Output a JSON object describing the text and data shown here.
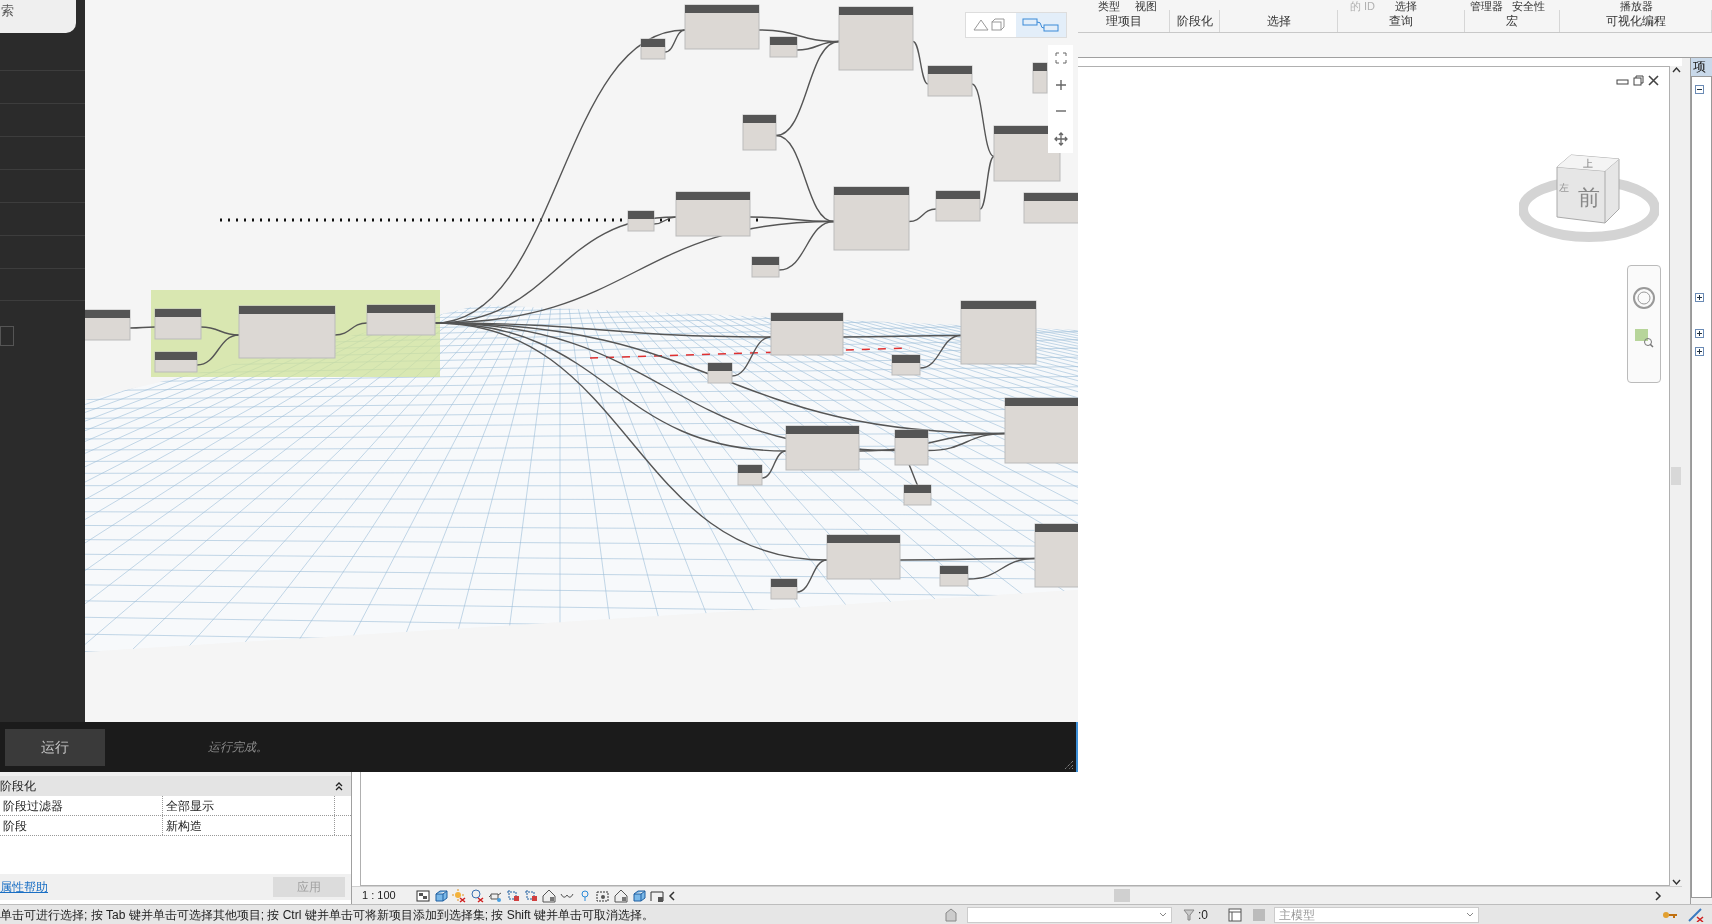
{
  "dynamo": {
    "search_field": {
      "value": "索"
    },
    "view_toggle": [
      {
        "selected": false
      },
      {
        "selected": true
      }
    ],
    "run_button": "运行",
    "run_message": "运行完成。"
  },
  "ribbon": {
    "tab_fragments": [
      {
        "label": "类型",
        "disabled": false
      },
      {
        "label": "视图",
        "disabled": false
      },
      {
        "label": "的 ID",
        "disabled": true
      },
      {
        "label": "选择",
        "disabled": false
      },
      {
        "label": "管理器",
        "disabled": false
      },
      {
        "label": "安全性",
        "disabled": false
      },
      {
        "label": "播放器",
        "disabled": false
      }
    ],
    "panels": [
      "理项目",
      "阶段化",
      "选择",
      "查询",
      "宏",
      "可视化编程"
    ]
  },
  "viewcube": {
    "faces": [
      "上",
      "左",
      "前"
    ]
  },
  "project_browser": {
    "header": "项"
  },
  "properties": {
    "group": {
      "label": "阶段化",
      "expanded": true
    },
    "rows": [
      {
        "name": "阶段过滤器",
        "value": "全部显示"
      },
      {
        "name": "阶段",
        "value": "新构造"
      }
    ],
    "help_link": "属性帮助",
    "apply_button": {
      "label": "应用",
      "disabled": true
    }
  },
  "view_control_bar": {
    "scale": "1 : 100"
  },
  "status_bar": {
    "message": "单击可进行选择; 按 Tab 键并单击可选择其他项目; 按 Ctrl 键并单击可将新项目添加到选择集; 按 Shift 键并单击可取消选择。",
    "selection_count": ":0",
    "workset": "主模型"
  }
}
